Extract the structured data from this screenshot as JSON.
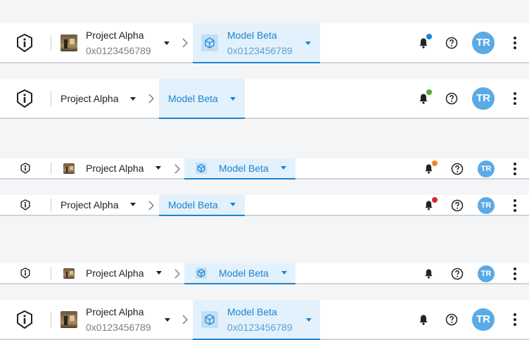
{
  "avatar": {
    "initials": "TR"
  },
  "colors": {
    "model_accent": "#1b84cf",
    "avatar_bg": "#5aaae6"
  },
  "bars": [
    {
      "project": {
        "name": "Project Alpha",
        "id": "0x0123456789",
        "has_thumbnail": true
      },
      "model": {
        "name": "Model Beta",
        "id": "0x0123456789",
        "has_icon": true
      },
      "notification_dot": "#1b84cf"
    },
    {
      "project": {
        "name": "Project Alpha",
        "has_thumbnail": false
      },
      "model": {
        "name": "Model Beta",
        "has_icon": false
      },
      "notification_dot": "#52a834"
    },
    {
      "project": {
        "name": "Project Alpha",
        "has_thumbnail": true
      },
      "model": {
        "name": "Model Beta",
        "has_icon": true
      },
      "notification_dot": "#f08c1e"
    },
    {
      "project": {
        "name": "Project Alpha",
        "has_thumbnail": false
      },
      "model": {
        "name": "Model Beta",
        "has_icon": false
      },
      "notification_dot": "#d9272e"
    },
    {
      "project": {
        "name": "Project Alpha",
        "has_thumbnail": true
      },
      "model": {
        "name": "Model Beta",
        "has_icon": true
      },
      "notification_dot": null
    },
    {
      "project": {
        "name": "Project Alpha",
        "id": "0x0123456789",
        "has_thumbnail": true
      },
      "model": {
        "name": "Model Beta",
        "id": "0x0123456789",
        "has_icon": true
      },
      "notification_dot": null
    }
  ]
}
